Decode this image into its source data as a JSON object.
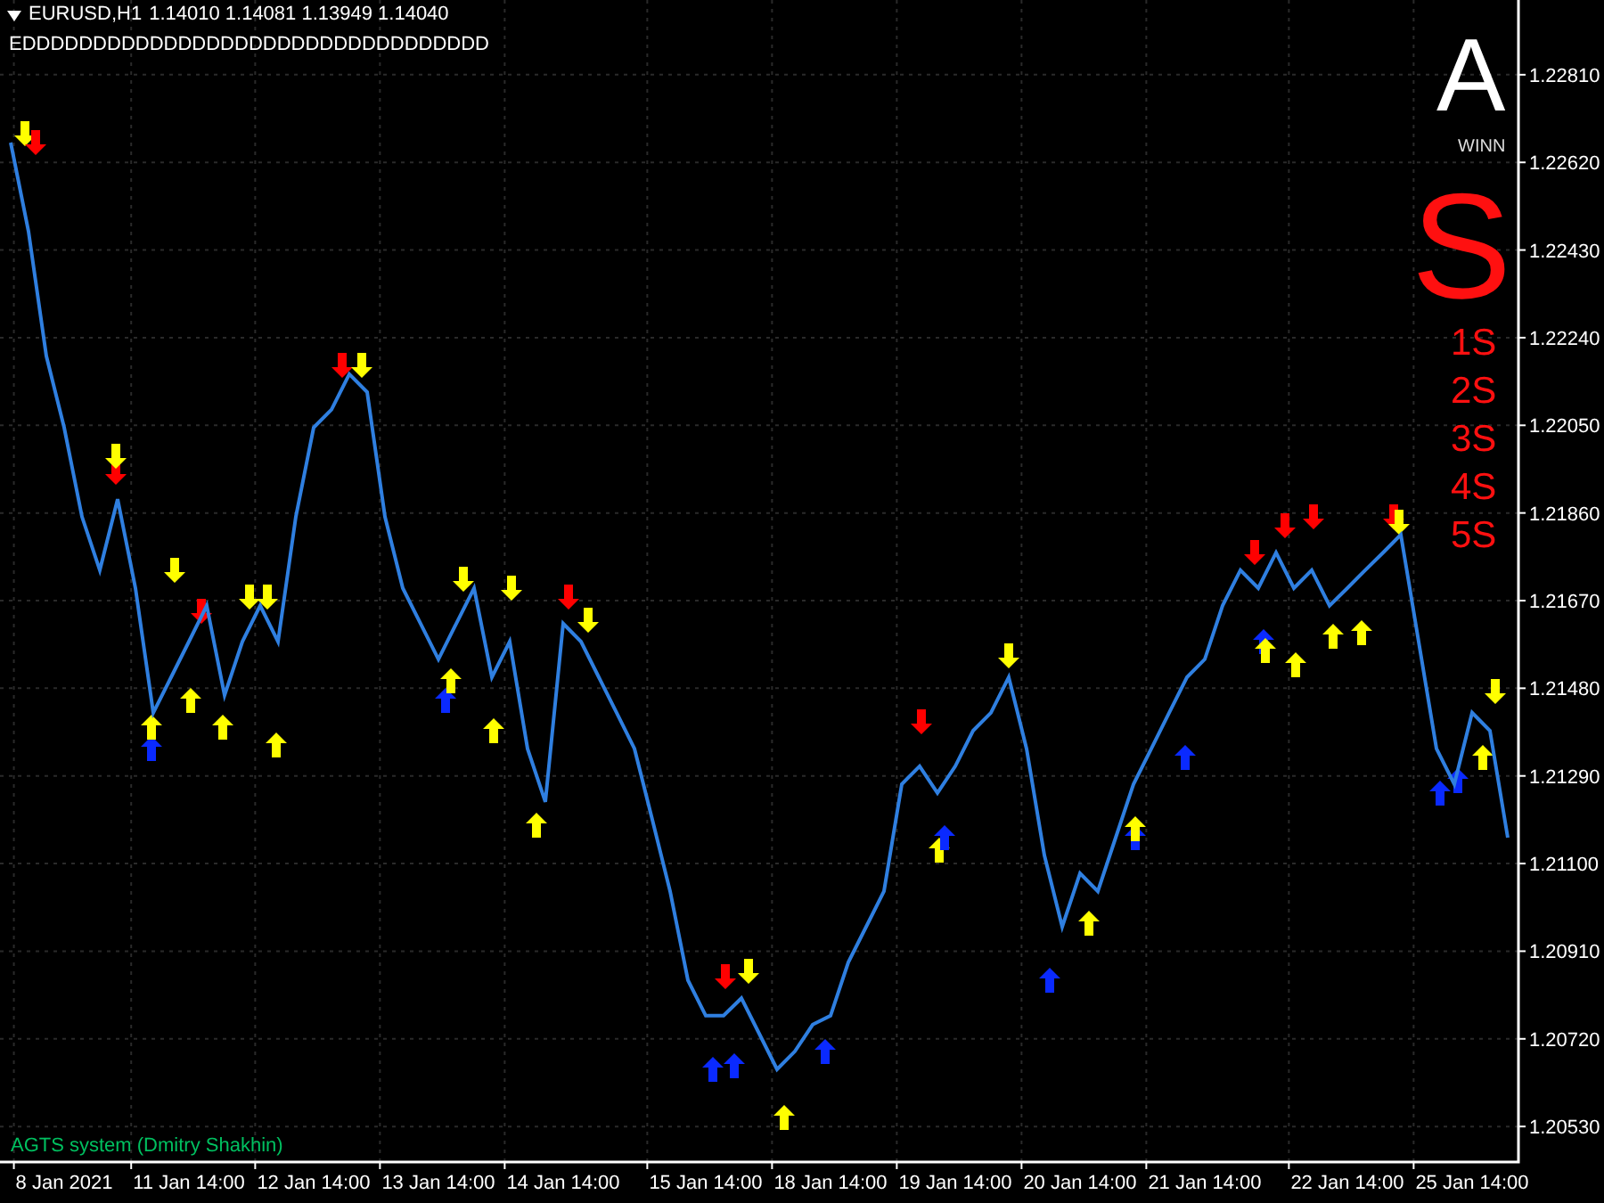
{
  "header": {
    "quotes": "1.14010 1.14081 1.13949 1.14040",
    "comment": "EDDDDDDDDDDDDDDDDDDDDDDDDDDDDDDDDD"
  },
  "panel": {
    "big_letter": "A",
    "caption": "WINN",
    "signal_letter": "S",
    "levels": [
      "1S",
      "2S",
      "3S",
      "4S",
      "5S"
    ]
  },
  "footer_label": "AGTS system (Dmitry Shakhin)",
  "chart": {
    "chart_data": {
      "type": "line",
      "categories": [
        null,
        null,
        null,
        null,
        null,
        null,
        "8 Jan 2021",
        null,
        null,
        null,
        null,
        null,
        null,
        "11 Jan 14:00",
        null,
        null,
        null,
        null,
        null,
        null,
        "12 Jan 14:00",
        null,
        null,
        null,
        null,
        null,
        null,
        "13 Jan 14:00",
        null,
        null,
        null,
        null,
        null,
        null,
        "14 Jan 14:00",
        null,
        null,
        null,
        null,
        null,
        null,
        null,
        "15 Jan 14:00",
        null,
        null,
        null,
        null,
        null,
        null,
        "18 Jan 14:00",
        null,
        null,
        null,
        null,
        null,
        null,
        "19 Jan 14:00",
        null,
        null,
        null,
        null,
        null,
        null,
        "20 Jan 14:00",
        null,
        null,
        null,
        null,
        null,
        null,
        "21 Jan 14:00",
        null,
        null,
        null,
        null,
        null,
        null,
        null,
        "22 Jan 14:00",
        null,
        null,
        null,
        null,
        null,
        null,
        "25 Jan 14:00",
        null,
        null
      ],
      "series": [
        {
          "name": "EURUSD,H1",
          "color": "#2f7fe0",
          "values": [
            null,
            null,
            null,
            1.22663,
            1.2247,
            1.222,
            1.22045,
            1.21852,
            1.21736,
            1.2189,
            1.21697,
            1.21427,
            1.21504,
            1.21581,
            1.21659,
            1.21465,
            1.21581,
            1.21659,
            1.21581,
            1.21852,
            1.22045,
            1.22084,
            1.22161,
            1.22122,
            1.21852,
            1.21697,
            1.2162,
            1.21543,
            1.2162,
            1.21697,
            1.21504,
            1.21581,
            1.21349,
            1.21234,
            1.2162,
            1.21581,
            1.21504,
            1.21427,
            1.21349,
            1.21195,
            1.2104,
            1.20847,
            1.2077,
            1.2077,
            1.20808,
            1.20731,
            1.20654,
            1.20693,
            1.20751,
            1.2077,
            1.20886,
            1.20963,
            1.2104,
            1.21272,
            1.21311,
            1.21253,
            1.21311,
            1.21388,
            1.21427,
            1.21504,
            1.21349,
            1.21118,
            1.20963,
            1.21079,
            1.2104,
            1.21156,
            1.21272,
            1.21349,
            1.21427,
            1.21504,
            1.21543,
            1.21659,
            1.21736,
            1.21697,
            1.21774,
            1.21697,
            1.21736,
            1.21659,
            1.21697,
            1.21736,
            1.21774,
            1.21813,
            1.21581,
            1.21349,
            1.21272,
            1.21427,
            1.21388,
            1.21156
          ]
        }
      ],
      "ylim": [
        1.20453,
        1.22972
      ],
      "grid": true,
      "yticks": [
        {
          "value": 1.2281,
          "label": "1.22810"
        },
        {
          "value": 1.2262,
          "label": "1.22620"
        },
        {
          "value": 1.2243,
          "label": "1.22430"
        },
        {
          "value": 1.2224,
          "label": "1.22240"
        },
        {
          "value": 1.2205,
          "label": "1.22050"
        },
        {
          "value": 1.2186,
          "label": "1.21860"
        },
        {
          "value": 1.2167,
          "label": "1.21670"
        },
        {
          "value": 1.2148,
          "label": "1.21480"
        },
        {
          "value": 1.2129,
          "label": "1.21290"
        },
        {
          "value": 1.211,
          "label": "1.21100"
        },
        {
          "value": 1.2091,
          "label": "1.20910"
        },
        {
          "value": 1.2072,
          "label": "1.20720"
        },
        {
          "value": 1.2053,
          "label": "1.20530"
        }
      ]
    }
  }
}
